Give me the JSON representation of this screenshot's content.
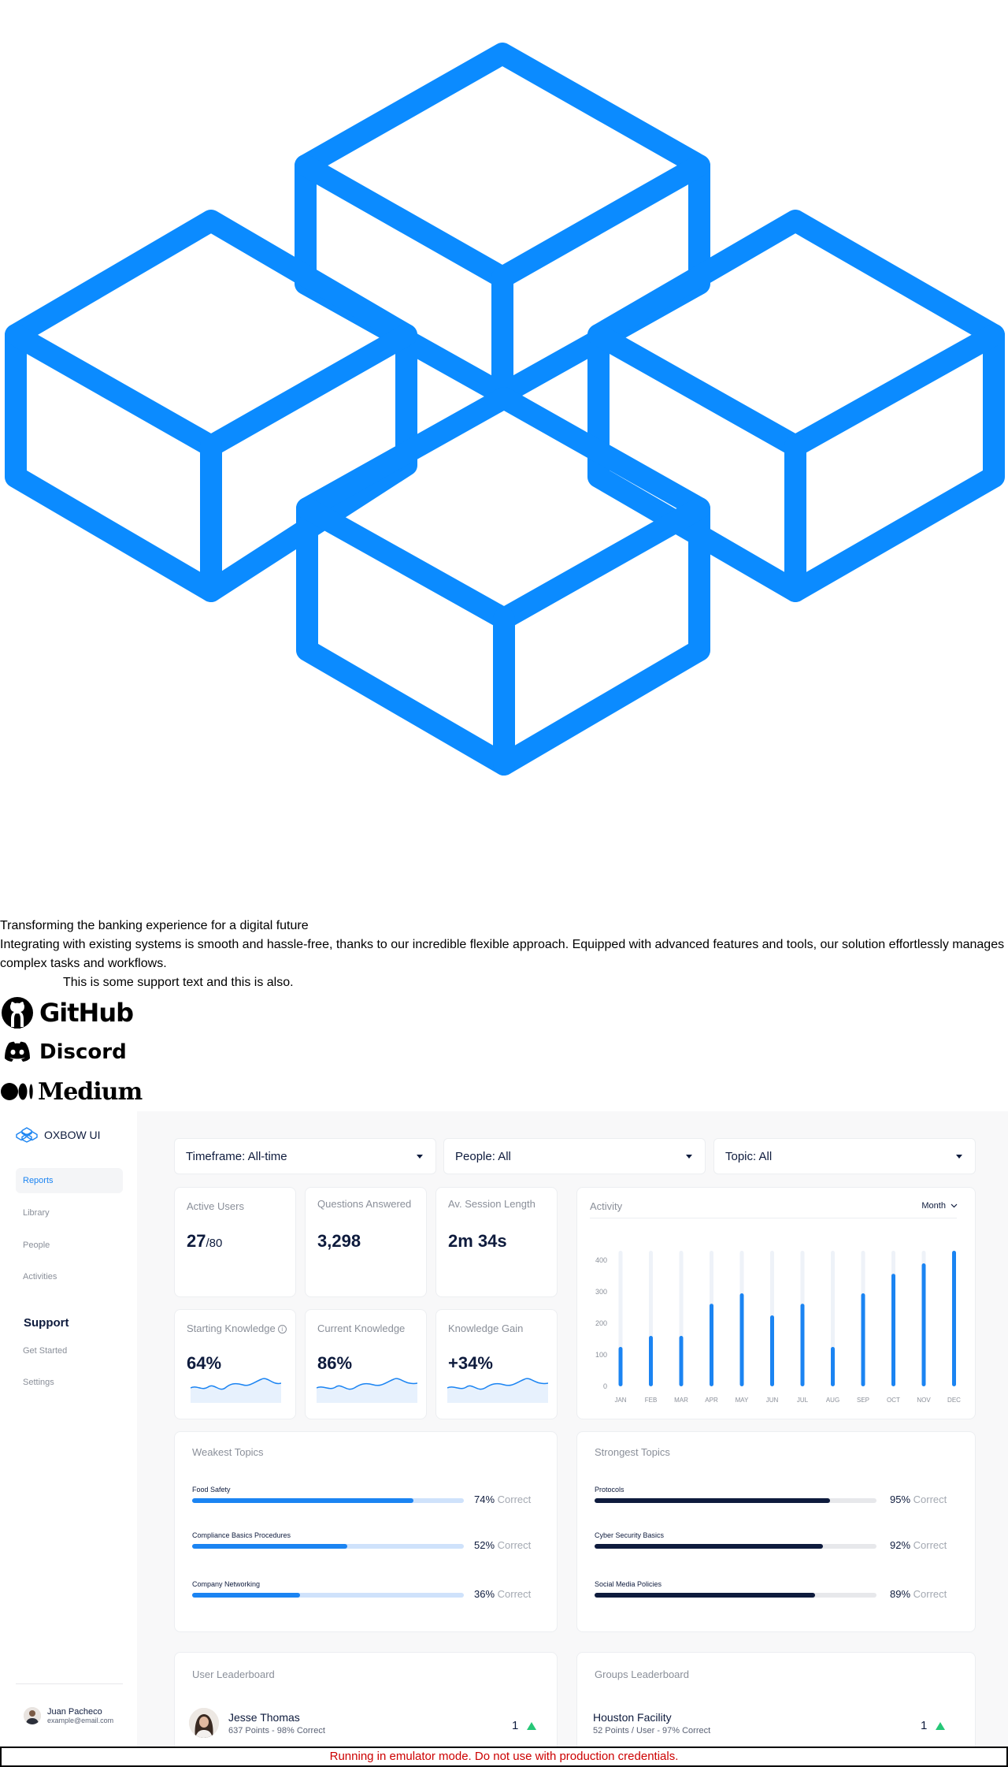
{
  "marketing": {
    "headline": "Transforming the banking experience for a digital future",
    "body": "Integrating with existing systems is smooth and hassle-free, thanks to our incredible flexible approach. Equipped with advanced features and tools, our solution effortlessly manages complex tasks and workflows.",
    "support": "This is some support text and this is also."
  },
  "hero_icon": "isometric-cubes-logo",
  "partner_logos": [
    {
      "name": "GitHub",
      "icon": "github-icon"
    },
    {
      "name": "Discord",
      "icon": "discord-icon"
    },
    {
      "name": "Medium",
      "icon": "medium-icon"
    }
  ],
  "colors": {
    "accent": "#1b84f2",
    "navy": "#0e1b3d",
    "positive": "#26c777",
    "muted": "#8a8f99"
  },
  "sidebar": {
    "brand": "OXBOW UI",
    "nav": [
      "Reports",
      "Library",
      "People",
      "Activities"
    ],
    "support_heading": "Support",
    "support_items": [
      "Get Started",
      "Settings"
    ],
    "user": {
      "name": "Juan Pacheco",
      "email": "example@email.com"
    }
  },
  "filters": {
    "timeframe": "Timeframe: All-time",
    "people": "People: All",
    "topic": "Topic: All"
  },
  "kpis": {
    "active_users": {
      "label": "Active Users",
      "value": "27",
      "suffix": "/80"
    },
    "questions": {
      "label": "Questions Answered",
      "value": "3,298"
    },
    "session": {
      "label": "Av. Session Length",
      "value": "2m 34s"
    },
    "starting": {
      "label": "Starting Knowledge",
      "value": "64%"
    },
    "current": {
      "label": "Current Knowledge",
      "value": "86%"
    },
    "gain": {
      "label": "Knowledge Gain",
      "value": "+34%"
    }
  },
  "activity": {
    "title": "Activity",
    "period": "Month"
  },
  "chart_data": {
    "type": "bar",
    "title": "Activity",
    "categories": [
      "JAN",
      "FEB",
      "MAR",
      "APR",
      "MAY",
      "JUN",
      "JUL",
      "AUG",
      "SEP",
      "OCT",
      "NOV",
      "DEC"
    ],
    "values": [
      125,
      160,
      160,
      262,
      295,
      225,
      262,
      125,
      295,
      357,
      390,
      430
    ],
    "yticks": [
      "400",
      "300",
      "200",
      "100",
      "0"
    ],
    "ylim": [
      0,
      430
    ],
    "grid": false
  },
  "weakest": {
    "title": "Weakest Topics",
    "items": [
      {
        "name": "Food Safety",
        "pct": 74,
        "pct_label": "74%"
      },
      {
        "name": "Compliance Basics Procedures",
        "pct": 52,
        "pct_label": "52%"
      },
      {
        "name": "Company Networking",
        "pct": 36,
        "pct_label": "36%"
      }
    ]
  },
  "strongest": {
    "title": "Strongest Topics",
    "items": [
      {
        "name": "Protocols",
        "pct": 95,
        "pct_label": "95%"
      },
      {
        "name": "Cyber Security Basics",
        "pct": 92,
        "pct_label": "92%"
      },
      {
        "name": "Social Media Policies",
        "pct": 89,
        "pct_label": "89%"
      }
    ]
  },
  "correct_label": "Correct",
  "user_leaderboard": {
    "title": "User Leaderboard",
    "top": {
      "name": "Jesse Thomas",
      "detail": "637 Points - 98% Correct",
      "rank": "1"
    }
  },
  "groups_leaderboard": {
    "title": "Groups Leaderboard",
    "top": {
      "name": "Houston Facility",
      "detail": "52 Points / User - 97% Correct",
      "rank": "1"
    }
  },
  "banner": "Running in emulator mode. Do not use with production credentials."
}
